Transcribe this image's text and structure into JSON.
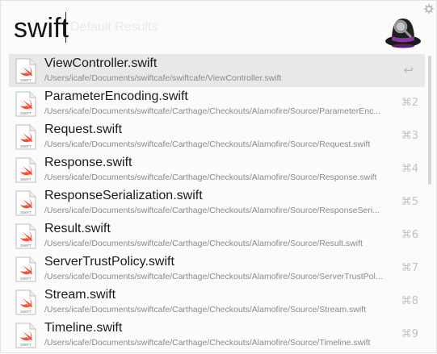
{
  "search": {
    "query": "swift",
    "ghost_text": "Default Results"
  },
  "results": [
    {
      "title": "ViewController.swift",
      "path": "/Users/icafe/Documents/swiftcafe/swiftcafe/ViewController.swift",
      "shortcut": "↩",
      "icon_label": "SWIFT",
      "selected": true
    },
    {
      "title": "ParameterEncoding.swift",
      "path": "/Users/icafe/Documents/swiftcafe/Carthage/Checkouts/Alamofire/Source/ParameterEnc...",
      "shortcut": "⌘2",
      "icon_label": "SWIFT",
      "selected": false
    },
    {
      "title": "Request.swift",
      "path": "/Users/icafe/Documents/swiftcafe/Carthage/Checkouts/Alamofire/Source/Request.swift",
      "shortcut": "⌘3",
      "icon_label": "SWIFT",
      "selected": false
    },
    {
      "title": "Response.swift",
      "path": "/Users/icafe/Documents/swiftcafe/Carthage/Checkouts/Alamofire/Source/Response.swift",
      "shortcut": "⌘4",
      "icon_label": "SWIFT",
      "selected": false
    },
    {
      "title": "ResponseSerialization.swift",
      "path": "/Users/icafe/Documents/swiftcafe/Carthage/Checkouts/Alamofire/Source/ResponseSeri...",
      "shortcut": "⌘5",
      "icon_label": "SWIFT",
      "selected": false
    },
    {
      "title": "Result.swift",
      "path": "/Users/icafe/Documents/swiftcafe/Carthage/Checkouts/Alamofire/Source/Result.swift",
      "shortcut": "⌘6",
      "icon_label": "SWIFT",
      "selected": false
    },
    {
      "title": "ServerTrustPolicy.swift",
      "path": "/Users/icafe/Documents/swiftcafe/Carthage/Checkouts/Alamofire/Source/ServerTrustPol...",
      "shortcut": "⌘7",
      "icon_label": "SWIFT",
      "selected": false
    },
    {
      "title": "Stream.swift",
      "path": "/Users/icafe/Documents/swiftcafe/Carthage/Checkouts/Alamofire/Source/Stream.swift",
      "shortcut": "⌘8",
      "icon_label": "SWIFT",
      "selected": false
    },
    {
      "title": "Timeline.swift",
      "path": "/Users/icafe/Documents/swiftcafe/Carthage/Checkouts/Alamofire/Source/Timeline.swift",
      "shortcut": "⌘9",
      "icon_label": "SWIFT",
      "selected": false
    }
  ],
  "icons": {
    "app_logo": "alfred-hat-icon",
    "settings": "gear-icon",
    "file": "swift-file-icon",
    "return": "return-key-icon"
  },
  "colors": {
    "selected_row": "#e8e8e8",
    "swift_orange": "#f05138",
    "hat_purple": "#7b2d8e",
    "path_text": "#8a8a8a",
    "shortcut_text": "#c2c2c2"
  }
}
